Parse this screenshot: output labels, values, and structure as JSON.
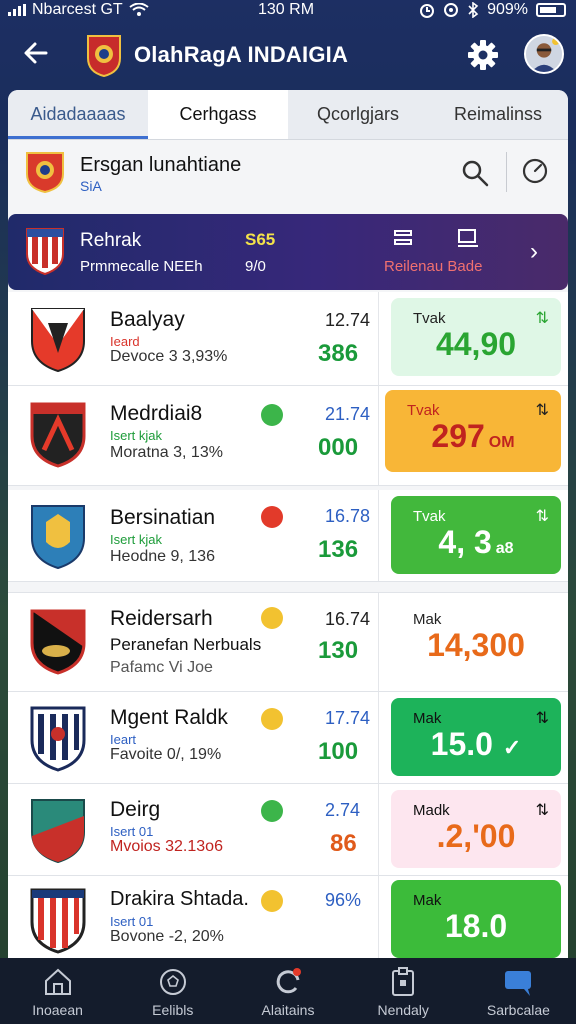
{
  "status_bar": {
    "carrier": "Nbarcest GT",
    "time": "130 RM",
    "battery": "909%"
  },
  "header": {
    "title": "OlahRagA INDAIGIA"
  },
  "tabs": [
    {
      "label": "Aidadaaaas"
    },
    {
      "label": "Cerhgass"
    },
    {
      "label": "Qcorlgjars"
    },
    {
      "label": "Reimalinss"
    }
  ],
  "league": {
    "name": "Ersgan lunahtiane",
    "sub": "SiA"
  },
  "featured": {
    "team": "Rehrak",
    "sub": "Prmmecalle NEEh",
    "score": "S65",
    "score2": "9/0",
    "label": "Reilenau Bade"
  },
  "teams": [
    {
      "name": "Baalyay",
      "tag": "Ieard",
      "meta": "Devoce 3 3,93%",
      "pct": "12.74",
      "pts": "386",
      "odds_label": "Tvak",
      "odds_value": "44,90",
      "odds_color": "#2aa532",
      "odds_bg": "#dff7e6",
      "tag_color": "#d9342b",
      "indicator": ""
    },
    {
      "name": "Medrdiai8",
      "tag": "Isert kjak",
      "meta": "Moratna 3, 13%",
      "pct": "21.74",
      "pts": "000",
      "odds_label": "Tvak",
      "odds_value": "297",
      "odds_suffix": "OM",
      "odds_color": "#c0231f",
      "odds_bg": "#f8b637",
      "tag_color": "#1e9c3a",
      "indicator": "#3cb54a"
    },
    {
      "name": "Bersinatian",
      "tag": "Isert kjak",
      "meta": "Heodne 9, 136",
      "pct": "16.78",
      "pts": "136",
      "odds_label": "Tvak",
      "odds_value": "4, 3",
      "odds_suffix": "a8",
      "odds_color": "#ffffff",
      "odds_bg": "#42b83c",
      "tag_color": "#1e9c3a",
      "indicator": "#e23a2a"
    },
    {
      "name": "Reidersarh",
      "tag": "Peranefan Nerbuals",
      "meta": "Pafamc Vi Joe",
      "pct": "16.74",
      "pts": "130",
      "odds_label": "Mak",
      "odds_value": "14,300",
      "odds_color": "#e86a1a",
      "odds_bg": "#ffffff",
      "tag_color": "#111111",
      "indicator": "#f2c230"
    },
    {
      "name": "Mgent Raldk",
      "tag": "Ieart",
      "meta": "Favoite 0/, 19%",
      "pct": "17.74",
      "pts": "100",
      "odds_label": "Mak",
      "odds_value": "15.0",
      "odds_color": "#ffffff",
      "odds_bg": "#1db35a",
      "tag_color": "#2d5fc2",
      "indicator": "#f2c230"
    },
    {
      "name": "Deirg",
      "tag": "Isert 01",
      "meta": "Mvoios 32.13o6",
      "pct": "2.74",
      "pts": "86",
      "odds_label": "Madk",
      "odds_value": ".2,'00",
      "odds_color": "#e86a1a",
      "odds_bg": "#fde6ef",
      "tag_color": "#2d5fc2",
      "indicator": "#3cb54a"
    },
    {
      "name": "Drakira Shtada.",
      "tag": "Isert 01",
      "meta": "Bovone -2, 20%",
      "pct": "96%",
      "pts": "",
      "odds_label": "Mak",
      "odds_value": "18.0",
      "odds_color": "#ffffff",
      "odds_bg": "#3cbb3a",
      "tag_color": "#2d5fc2",
      "indicator": "#f2c230"
    }
  ],
  "nav": [
    {
      "label": "Inoaean"
    },
    {
      "label": "Eelibls"
    },
    {
      "label": "Alaitains"
    },
    {
      "label": "Nendaly"
    },
    {
      "label": "Sarbcalae"
    }
  ]
}
